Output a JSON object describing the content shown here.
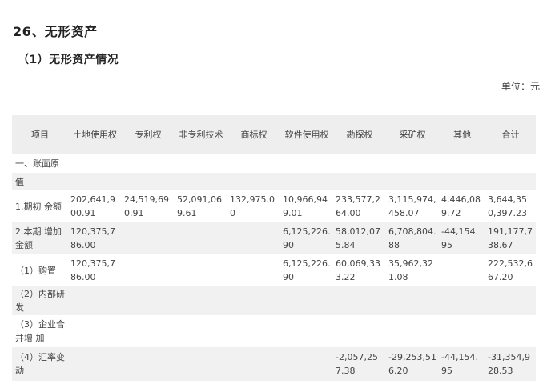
{
  "heading": "26、无形资产",
  "subheading": "（1）无形资产情况",
  "unit": "单位：元",
  "table": {
    "columns": [
      "项目",
      "土地使用权",
      "专利权",
      "非专利技术",
      "商标权",
      "软件使用权",
      "勘探权",
      "采矿权",
      "其他",
      "合计"
    ],
    "rows": [
      [
        "一、账面原",
        "",
        "",
        "",
        "",
        "",
        "",
        "",
        "",
        ""
      ],
      [
        "值",
        "",
        "",
        "",
        "",
        "",
        "",
        "",
        "",
        ""
      ],
      [
        "1.期初 余额",
        "202,641,900.91",
        "24,519,690.91",
        "52,091,069.61",
        "132,975.00",
        "10,966,949.01",
        "233,577,264.00",
        "3,115,974,458.07",
        "4,446,089.72",
        "3,644,350,397.23"
      ],
      [
        "2.本期 增加金额",
        "120,375,786.00",
        "",
        "",
        "",
        "6,125,226.90",
        "58,012,075.84",
        "6,708,804.88",
        "-44,154.95",
        "191,177,738.67"
      ],
      [
        "（1）购置",
        "120,375,786.00",
        "",
        "",
        "",
        "6,125,226.90",
        "60,069,333.22",
        "35,962,321.08",
        "",
        "222,532,667.20"
      ],
      [
        "（2）内部研发",
        "",
        "",
        "",
        "",
        "",
        "",
        "",
        "",
        ""
      ],
      [
        "（3）企业合并增 加",
        "",
        "",
        "",
        "",
        "",
        "",
        "",
        "",
        ""
      ],
      [
        "（4）汇率变 动",
        "",
        "",
        "",
        "",
        "",
        "-2,057,257.38",
        "-29,253,516.20",
        "-44,154.95",
        "-31,354,928.53"
      ]
    ]
  }
}
